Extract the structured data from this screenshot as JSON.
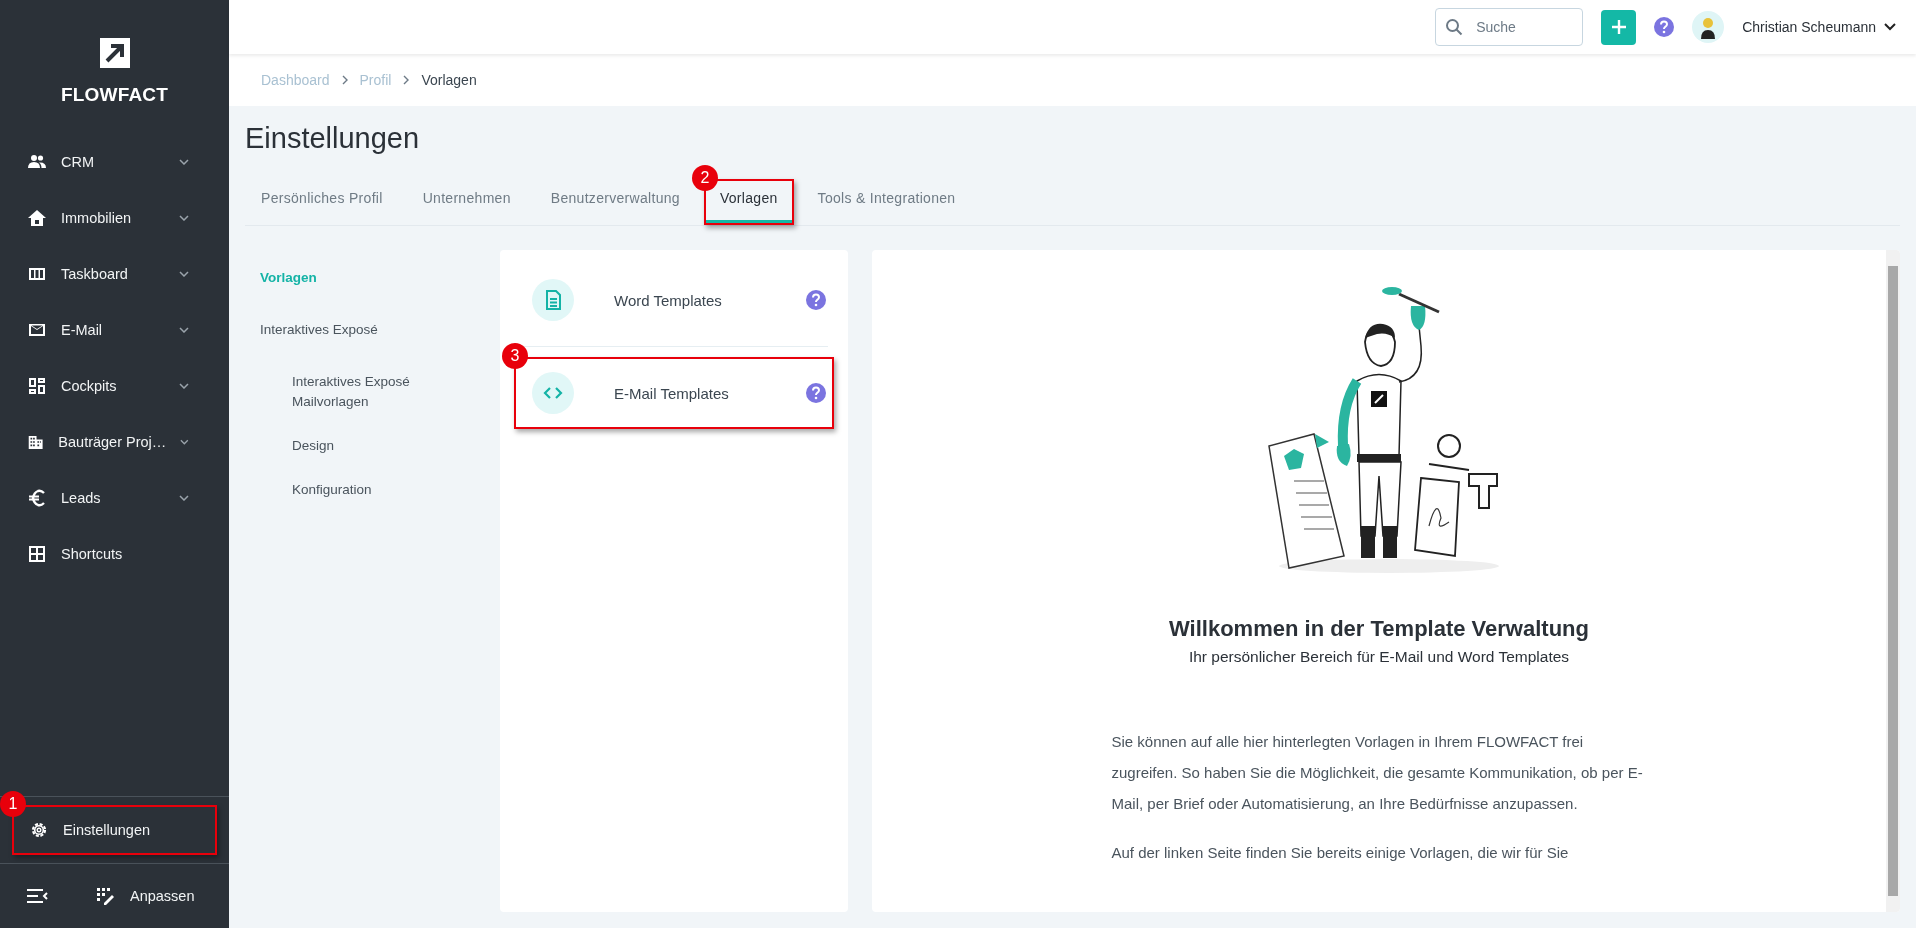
{
  "sidebar": {
    "logo": "FLOWFACT",
    "items": [
      {
        "label": "CRM",
        "has_submenu": true
      },
      {
        "label": "Immobilien",
        "has_submenu": true
      },
      {
        "label": "Taskboard",
        "has_submenu": true
      },
      {
        "label": "E-Mail",
        "has_submenu": true
      },
      {
        "label": "Cockpits",
        "has_submenu": true
      },
      {
        "label": "Bauträger Proj…",
        "has_submenu": true
      },
      {
        "label": "Leads",
        "has_submenu": true
      },
      {
        "label": "Shortcuts",
        "has_submenu": false
      }
    ],
    "settings": {
      "label": "Einstellungen",
      "callout": "1"
    },
    "customize": {
      "label": "Anpassen"
    }
  },
  "topbar": {
    "search": {
      "placeholder": "Suche"
    },
    "user": {
      "name": "Christian Scheumann"
    }
  },
  "breadcrumb": [
    {
      "label": "Dashboard",
      "link": true
    },
    {
      "label": "Profil",
      "link": true
    },
    {
      "label": "Vorlagen",
      "link": false
    }
  ],
  "page_title": "Einstellungen",
  "tabs": [
    {
      "label": "Persönliches Profil",
      "selected": false
    },
    {
      "label": "Unternehmen",
      "selected": false
    },
    {
      "label": "Benutzerverwaltung",
      "selected": false
    },
    {
      "label": "Vorlagen",
      "selected": true,
      "callout": "2"
    },
    {
      "label": "Tools & Integrationen",
      "selected": false
    }
  ],
  "subnav": [
    {
      "label": "Vorlagen",
      "selected": true
    },
    {
      "label": "Interaktives Exposé",
      "selected": false,
      "children": [
        {
          "label": "Interaktives Exposé Mailvorlagen",
          "selected": false
        },
        {
          "label": "Design",
          "selected": false
        },
        {
          "label": "Konfiguration",
          "selected": false
        }
      ]
    }
  ],
  "templates": [
    {
      "label": "Word Templates"
    },
    {
      "label": "E-Mail Templates",
      "callout": "3"
    }
  ],
  "welcome": {
    "title": "Willkommen in der Template Verwaltung",
    "subtitle": "Ihr persönlicher Bereich für E-Mail und Word Templates",
    "paragraphs": [
      "Sie können auf alle hier hinterlegten Vorlagen in Ihrem FLOWFACT frei zugreifen. So haben Sie die Möglichkeit, die gesamte Kommunikation, ob per E-Mail, per Brief oder Automatisierung, an Ihre Bedürfnisse anzupassen.",
      "Auf der linken Seite finden Sie bereits einige Vorlagen, die wir für Sie"
    ]
  }
}
